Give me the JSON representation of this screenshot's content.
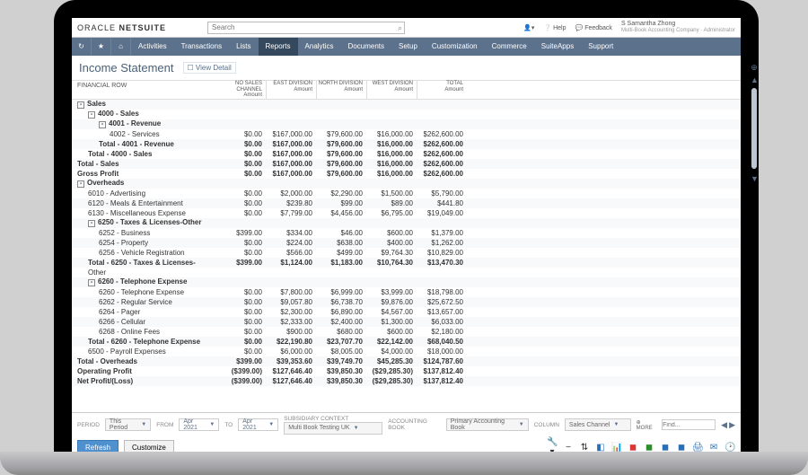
{
  "brand": {
    "left": "ORACLE",
    "right": "NETSUITE"
  },
  "search": {
    "placeholder": "Search"
  },
  "toplinks": {
    "help": "Help",
    "feedback": "Feedback",
    "user_name": "S Samantha Zhong",
    "user_sub": "Multi-Book Accounting Company · Administrator"
  },
  "nav": [
    "Activities",
    "Transactions",
    "Lists",
    "Reports",
    "Analytics",
    "Documents",
    "Setup",
    "Customization",
    "Commerce",
    "SuiteApps",
    "Support"
  ],
  "nav_active": "Reports",
  "page": {
    "title": "Income Statement",
    "view_detail": "View Detail"
  },
  "columns": {
    "finrow": "FINANCIAL ROW",
    "cols": [
      {
        "top": "NO SALES CHANNEL",
        "sub": "Amount"
      },
      {
        "top": "EAST DIVISION",
        "sub": "Amount"
      },
      {
        "top": "NORTH DIVISION",
        "sub": "Amount"
      },
      {
        "top": "WEST DIVISION",
        "sub": "Amount"
      },
      {
        "top": "TOTAL",
        "sub": "Amount"
      }
    ]
  },
  "rows": [
    {
      "ind": 0,
      "bold": true,
      "tree": "-",
      "label": "Sales",
      "v": [
        "",
        "",
        "",
        "",
        ""
      ]
    },
    {
      "ind": 1,
      "bold": true,
      "tree": "-",
      "label": "4000 - Sales",
      "v": [
        "",
        "",
        "",
        "",
        ""
      ]
    },
    {
      "ind": 2,
      "bold": true,
      "tree": "-",
      "label": "4001 - Revenue",
      "v": [
        "",
        "",
        "",
        "",
        ""
      ]
    },
    {
      "ind": 3,
      "label": "4002 - Services",
      "v": [
        "$0.00",
        "$167,000.00",
        "$79,600.00",
        "$16,000.00",
        "$262,600.00"
      ]
    },
    {
      "ind": 2,
      "bold": true,
      "label": "Total - 4001 - Revenue",
      "v": [
        "$0.00",
        "$167,000.00",
        "$79,600.00",
        "$16,000.00",
        "$262,600.00"
      ]
    },
    {
      "ind": 1,
      "bold": true,
      "label": "Total - 4000 - Sales",
      "v": [
        "$0.00",
        "$167,000.00",
        "$79,600.00",
        "$16,000.00",
        "$262,600.00"
      ]
    },
    {
      "ind": 0,
      "bold": true,
      "label": "Total - Sales",
      "v": [
        "$0.00",
        "$167,000.00",
        "$79,600.00",
        "$16,000.00",
        "$262,600.00"
      ]
    },
    {
      "ind": 0,
      "bold": true,
      "label": "Gross Profit",
      "v": [
        "$0.00",
        "$167,000.00",
        "$79,600.00",
        "$16,000.00",
        "$262,600.00"
      ]
    },
    {
      "ind": 0,
      "bold": true,
      "tree": "-",
      "label": "Overheads",
      "v": [
        "",
        "",
        "",
        "",
        ""
      ]
    },
    {
      "ind": 1,
      "label": "6010 - Advertising",
      "v": [
        "$0.00",
        "$2,000.00",
        "$2,290.00",
        "$1,500.00",
        "$5,790.00"
      ]
    },
    {
      "ind": 1,
      "label": "6120 - Meals & Entertainment",
      "v": [
        "$0.00",
        "$239.80",
        "$99.00",
        "$89.00",
        "$441.80"
      ]
    },
    {
      "ind": 1,
      "label": "6130 - Miscellaneous Expense",
      "v": [
        "$0.00",
        "$7,799.00",
        "$4,456.00",
        "$6,795.00",
        "$19,049.00"
      ]
    },
    {
      "ind": 1,
      "bold": true,
      "tree": "-",
      "label": "6250 - Taxes & Licenses-Other",
      "v": [
        "",
        "",
        "",
        "",
        ""
      ]
    },
    {
      "ind": 2,
      "label": "6252 - Business",
      "v": [
        "$399.00",
        "$334.00",
        "$46.00",
        "$600.00",
        "$1,379.00"
      ]
    },
    {
      "ind": 2,
      "label": "6254 - Property",
      "v": [
        "$0.00",
        "$224.00",
        "$638.00",
        "$400.00",
        "$1,262.00"
      ]
    },
    {
      "ind": 2,
      "label": "6256 - Vehicle Registration",
      "v": [
        "$0.00",
        "$566.00",
        "$499.00",
        "$9,764.30",
        "$10,829.00"
      ]
    },
    {
      "ind": 1,
      "bold": true,
      "label": "Total - 6250 - Taxes & Licenses-",
      "v": [
        "$399.00",
        "$1,124.00",
        "$1,183.00",
        "$10,764.30",
        "$13,470.30"
      ]
    },
    {
      "ind": 1,
      "bold": false,
      "label": "Other",
      "v": [
        "",
        "",
        "",
        "",
        ""
      ]
    },
    {
      "ind": 1,
      "bold": true,
      "tree": "-",
      "label": "6260 - Telephone Expense",
      "v": [
        "",
        "",
        "",
        "",
        ""
      ]
    },
    {
      "ind": 2,
      "label": "6260 - Telephone Expense",
      "v": [
        "$0.00",
        "$7,800.00",
        "$6,999.00",
        "$3,999.00",
        "$18,798.00"
      ]
    },
    {
      "ind": 2,
      "label": "6262 - Regular Service",
      "v": [
        "$0.00",
        "$9,057.80",
        "$6,738.70",
        "$9,876.00",
        "$25,672.50"
      ]
    },
    {
      "ind": 2,
      "label": "6264 - Pager",
      "v": [
        "$0.00",
        "$2,300.00",
        "$6,890.00",
        "$4,567.00",
        "$13,657.00"
      ]
    },
    {
      "ind": 2,
      "label": "6266 - Cellular",
      "v": [
        "$0.00",
        "$2,333.00",
        "$2,400.00",
        "$1,300.00",
        "$6,033.00"
      ]
    },
    {
      "ind": 2,
      "label": "6268 - Online Fees",
      "v": [
        "$0.00",
        "$900.00",
        "$680.00",
        "$600.00",
        "$2,180.00"
      ]
    },
    {
      "ind": 1,
      "bold": true,
      "label": "Total - 6260 - Telephone Expense",
      "v": [
        "$0.00",
        "$22,190.80",
        "$23,707.70",
        "$22,142.00",
        "$68,040.50"
      ]
    },
    {
      "ind": 1,
      "label": "6500 - Payroll Expenses",
      "v": [
        "$0.00",
        "$6,000.00",
        "$8,005.00",
        "$4,000.00",
        "$18,000.00"
      ]
    },
    {
      "ind": 0,
      "bold": true,
      "label": "Total - Overheads",
      "v": [
        "$399.00",
        "$39,353.60",
        "$39,749.70",
        "$45,285.30",
        "$124,787.60"
      ]
    },
    {
      "ind": 0,
      "bold": true,
      "label": "Operating Profit",
      "v": [
        "($399.00)",
        "$127,646.40",
        "$39,850.30",
        "($29,285.30)",
        "$137,812.40"
      ]
    },
    {
      "ind": 0,
      "bold": true,
      "label": "Net Profit/(Loss)",
      "v": [
        "($399.00)",
        "$127,646.40",
        "$39,850.30",
        "($29,285.30)",
        "$137,812.40"
      ]
    }
  ],
  "footer": {
    "period_lbl": "PERIOD",
    "period": "This Period",
    "from_lbl": "FROM",
    "from": "Apr 2021",
    "to_lbl": "TO",
    "to": "Apr 2021",
    "sub_lbl": "SUBSIDIARY CONTEXT",
    "sub": "Multi Book Testing UK",
    "book_lbl": "ACCOUNTING BOOK",
    "book": "Primary Accounting Book",
    "col_lbl": "COLUMN",
    "col": "Sales Channel",
    "more": "MORE",
    "find_lbl": "Find...",
    "refresh": "Refresh",
    "customize": "Customize"
  }
}
